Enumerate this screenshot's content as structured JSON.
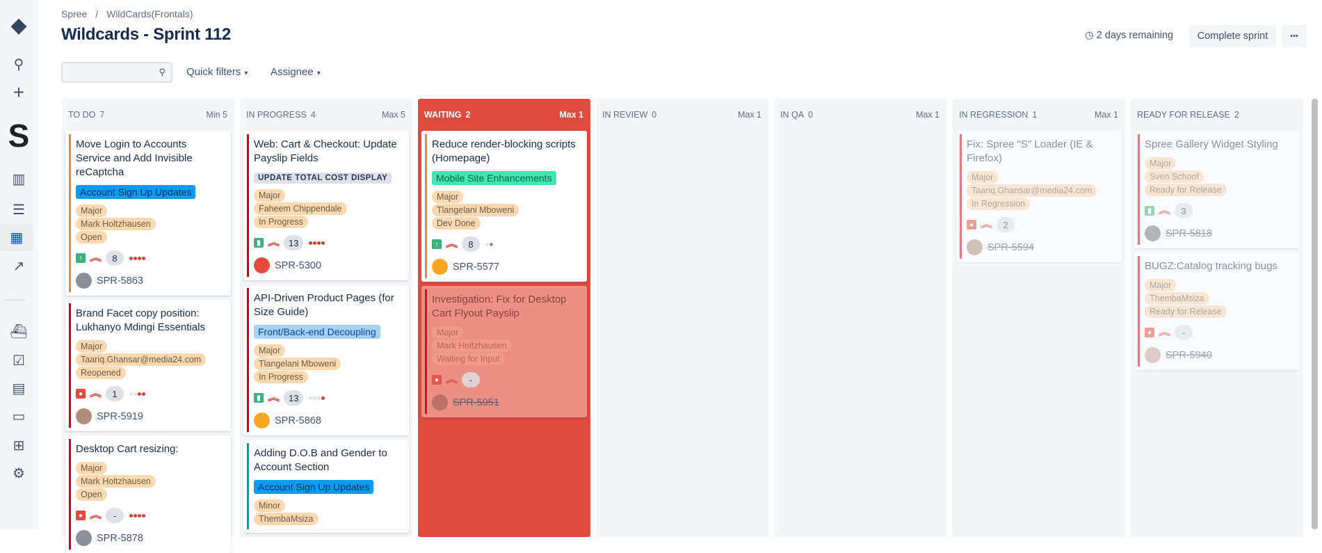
{
  "breadcrumb": [
    "Spree",
    "/",
    "WildCards(Frontals)"
  ],
  "title": "Wildcards - Sprint 112",
  "search": {
    "placeholder": ""
  },
  "filters": {
    "quick": "Quick filters",
    "assignee": "Assignee"
  },
  "sprint": {
    "remaining": "2 days remaining",
    "complete": "Complete sprint",
    "more": "•••"
  },
  "colors": {
    "over_limit": "#de4a3e",
    "pill": "#fbd9b0",
    "bug": "#e5493a",
    "story": "#36b37e",
    "improvement": "#36b37e"
  },
  "columns": [
    {
      "name": "TO DO",
      "count": "7",
      "limit": "Min 5",
      "cards": [
        {
          "title": "Move Login to Accounts Service and Add Invisible reCaptcha",
          "epic": "Account Sign Up Updates",
          "epic_bg": "#0a9cf5",
          "epic_fg": "#172b4d",
          "pills": [
            "Major",
            "Mark Holtzhausen",
            "Open"
          ],
          "type": "improvement",
          "estimate": "8",
          "dots": [
            "r",
            "r",
            "r",
            "r"
          ],
          "key": "SPR-5863",
          "bar": "#e8883a",
          "avatar": "#8a8f99"
        },
        {
          "title": "Brand Facet copy position: Lukhanyo Mdingi Essentials",
          "pills": [
            "Major",
            "Taariq.Ghansar@media24.com",
            "Reopened"
          ],
          "type": "bug",
          "estimate": "1",
          "dots": [
            "g",
            "g",
            "r",
            "r"
          ],
          "key": "SPR-5919",
          "bar": "#d0021b",
          "avatar": "#b08c7a"
        },
        {
          "title": "Desktop Cart resizing:",
          "pills": [
            "Major",
            "Mark Holtzhausen",
            "Open"
          ],
          "type": "bug",
          "estimate": "-",
          "dots": [
            "r",
            "r",
            "r",
            "r"
          ],
          "key": "SPR-5878",
          "bar": "#d0021b",
          "avatar": "#8a8f99"
        }
      ]
    },
    {
      "name": "IN PROGRESS",
      "count": "4",
      "limit": "Max 5",
      "cards": [
        {
          "title": "Web: Cart & Checkout: Update Payslip Fields",
          "epic": "UPDATE TOTAL COST DISPLAY",
          "epic_bg": "#dfe1e6",
          "epic_fg": "#253858",
          "epic_caps": true,
          "pills": [
            "Major",
            "Faheem Chippendale",
            "In Progress"
          ],
          "type": "story",
          "estimate": "13",
          "dots": [
            "r",
            "r",
            "r",
            "r"
          ],
          "key": "SPR-5300",
          "bar": "#d0021b",
          "avatar": "#e5493a"
        },
        {
          "title": "API-Driven Product Pages (for Size Guide)",
          "epic": "Front/Back-end Decoupling",
          "epic_bg": "#a7d0f5",
          "epic_fg": "#0747a6",
          "pills": [
            "Major",
            "Tlangelani Mboweni",
            "In Progress"
          ],
          "type": "story",
          "estimate": "13",
          "dots": [
            "g",
            "g",
            "g",
            "r"
          ],
          "key": "SPR-5868",
          "bar": "#d0021b",
          "avatar": "#f6a623"
        },
        {
          "title": "Adding D.O.B and Gender to Account Section",
          "epic": "Account Sign Up Updates",
          "epic_bg": "#0a9cf5",
          "epic_fg": "#172b4d",
          "pills": [
            "Minor",
            "ThembaMsiza"
          ],
          "type": "story",
          "estimate": "",
          "dots": [],
          "key": "",
          "bar": "#00a3a3",
          "avatar": ""
        }
      ]
    },
    {
      "name": "WAITING",
      "count": "2",
      "limit": "Max 1",
      "over": true,
      "cards": [
        {
          "title": "Reduce render-blocking scripts (Homepage)",
          "epic": "Mobile Site Enhancements",
          "epic_bg": "#3ee6b0",
          "epic_fg": "#064",
          "pills": [
            "Major",
            "Tlangelani Mboweni",
            "Dev Done"
          ],
          "type": "improvement",
          "estimate": "8",
          "dots": [
            "g",
            "d"
          ],
          "key": "SPR-5577",
          "bar": "#e8883a",
          "avatar": "#f6a623"
        },
        {
          "title": "Investigation: Fix for Desktop Cart Flyout Payslip",
          "pills": [
            "Major",
            "Mark Holtzhausen",
            "Waiting for Input"
          ],
          "type": "bug",
          "estimate": "-",
          "dots": [],
          "key": "SPR-5951",
          "bar": "#d0021b",
          "avatar": "#b06a60",
          "flag": true
        }
      ]
    },
    {
      "name": "IN REVIEW",
      "count": "0",
      "limit": "Max 1",
      "cards": []
    },
    {
      "name": "IN QA",
      "count": "0",
      "limit": "Max 1",
      "cards": []
    },
    {
      "name": "IN REGRESSION",
      "count": "1",
      "limit": "Max 1",
      "cards": [
        {
          "title": "Fix: Spree \"S\" Loader (IE & Firefox)",
          "pills": [
            "Major",
            "Taariq.Ghansar@media24.com",
            "In Regression"
          ],
          "type": "bug",
          "estimate": "2",
          "dots": [],
          "key": "SPR-5594",
          "bar": "#d0021b",
          "avatar": "#b08c7a",
          "done": true
        }
      ]
    },
    {
      "name": "READY FOR RELEASE",
      "count": "2",
      "limit": "",
      "cards": [
        {
          "title": "Spree Gallery Widget Styling",
          "pills": [
            "Major",
            "Sven Schoof",
            "Ready for Release"
          ],
          "type": "story",
          "estimate": "3",
          "dots": [],
          "key": "SPR-5818",
          "bar": "#d0021b",
          "avatar": "#777",
          "done": true
        },
        {
          "title": "BUGZ:Catalog tracking bugs",
          "pills": [
            "Major",
            "ThembaMsiza",
            "Ready for Release"
          ],
          "type": "bug",
          "estimate": "-",
          "dots": [],
          "key": "SPR-5940",
          "bar": "#d0021b",
          "avatar": "#c9a0a0",
          "done": true
        }
      ]
    }
  ]
}
